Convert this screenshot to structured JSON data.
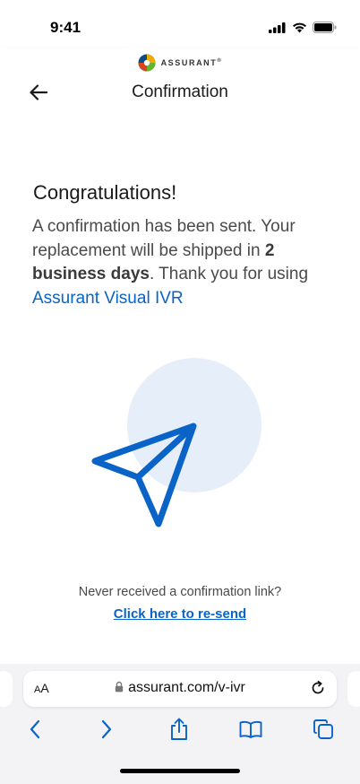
{
  "status_bar": {
    "time": "9:41"
  },
  "brand": {
    "name": "ASSURANT",
    "mark": "®"
  },
  "header": {
    "title": "Confirmation"
  },
  "content": {
    "heading": "Congratulations!",
    "message": {
      "part1": "A confirmation has been sent. Your replacement will be shipped in ",
      "bold": "2 business days",
      "part2": ". Thank you for using ",
      "link": "Assurant Visual IVR"
    },
    "resend_question": "Never received a confirmation link?",
    "resend_link": "Click here to re-send"
  },
  "browser": {
    "aa_label": "A",
    "aa_label_big": "A",
    "url": "assurant.com/v-ivr"
  },
  "colors": {
    "accent": "#0a63c6",
    "illustration_circle": "#e6eefa",
    "text_body": "#4a4a4a"
  }
}
